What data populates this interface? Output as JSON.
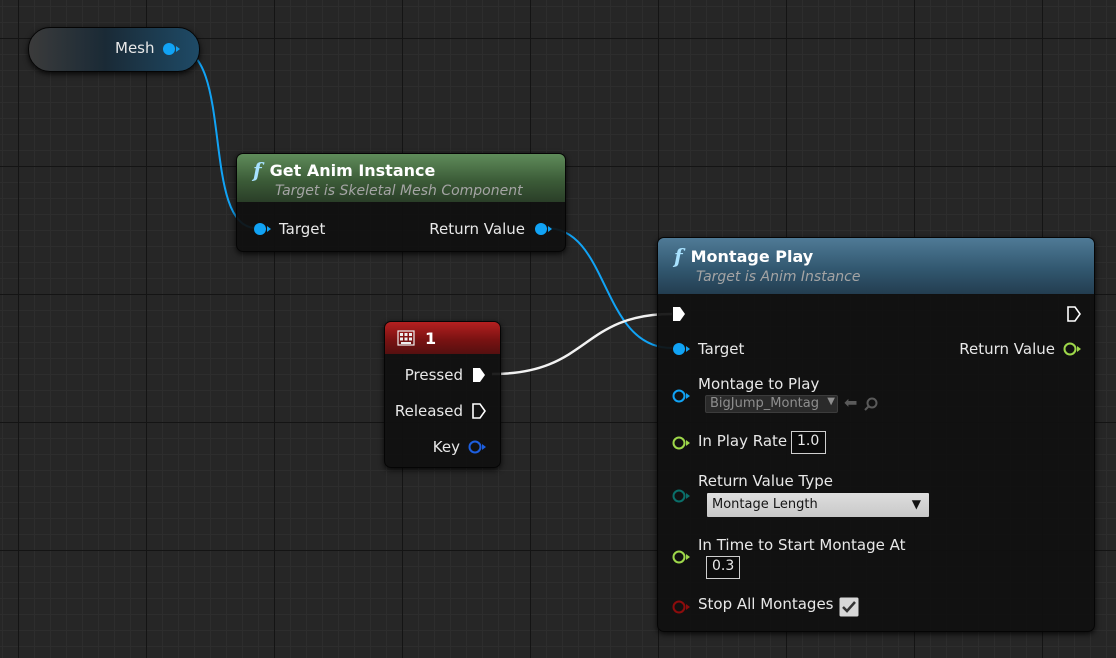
{
  "mesh_node": {
    "label": "Mesh"
  },
  "get_anim_instance": {
    "title": "Get Anim Instance",
    "subtitle": "Target is Skeletal Mesh Component",
    "input_target": "Target",
    "output_return_value": "Return Value"
  },
  "key_event": {
    "title": "1",
    "pressed": "Pressed",
    "released": "Released",
    "key": "Key"
  },
  "montage_play": {
    "title": "Montage Play",
    "subtitle": "Target is Anim Instance",
    "target": "Target",
    "return_value": "Return Value",
    "montage_to_play": "Montage to Play",
    "montage_asset": "BigJump_Montag",
    "in_play_rate": "In Play Rate",
    "in_play_rate_value": "1.0",
    "return_value_type": "Return Value Type",
    "return_value_type_selected": "Montage Length",
    "in_time_to_start": "In Time to Start Montage At",
    "in_time_to_start_value": "0.3",
    "stop_all_montages": "Stop All Montages",
    "stop_all_montages_checked": true
  },
  "colors": {
    "object_pin": "#11a3f5",
    "float_pin": "#9ed84a",
    "enum_pin": "#0a6f6a",
    "bool_pin": "#8d0c0c",
    "key_pin": "#1d5fe0",
    "exec_pin": "#ffffff"
  }
}
